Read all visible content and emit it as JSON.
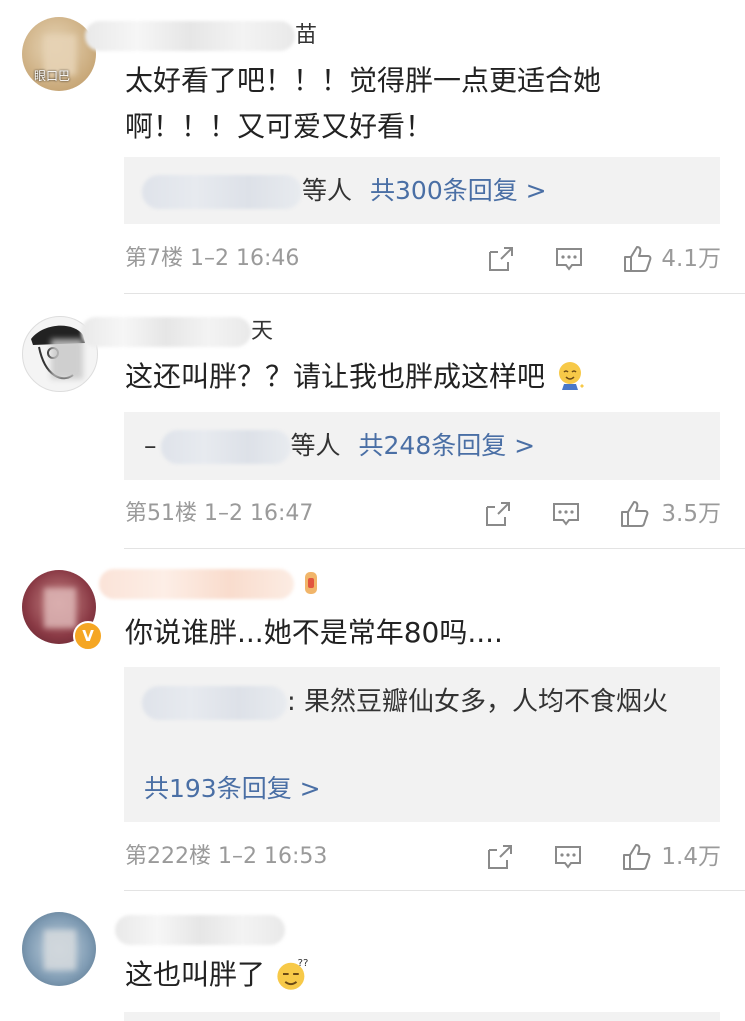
{
  "colors": {
    "link": "#4a6fa5",
    "meta_gray": "#9a9a9a",
    "reply_bg": "#f2f2f2",
    "verified_badge": "#f5a623"
  },
  "comments": [
    {
      "user_suffix": "苗",
      "avatar_text": "眼口巴",
      "text": "太好看了吧！！！觉得胖一点更适合她啊！！！又可爱又好看！",
      "reply_suffix": "等人",
      "reply_count": "共300条回复 >",
      "floor": "第7楼",
      "time": "1–2 16:46",
      "likes": "4.1万"
    },
    {
      "user_suffix": "天",
      "text": "这还叫胖？？请让我也胖成这样吧",
      "emoji": "crying-laughing-emoji",
      "reply_prefix": "–",
      "reply_suffix": "等人",
      "reply_count": "共248条回复 >",
      "floor": "第51楼",
      "time": "1–2 16:47",
      "likes": "3.5万"
    },
    {
      "text": "你说谁胖...她不是常年80吗....",
      "verified_badge": "V",
      "reply_quote": ": 果然豆瓣仙女多，人均不食烟火",
      "reply_count": "共193条回复 >",
      "floor": "第222楼",
      "time": "1–2 16:53",
      "likes": "1.4万"
    },
    {
      "text": "这也叫胖了",
      "emoji": "confused-sweat-emoji"
    }
  ]
}
